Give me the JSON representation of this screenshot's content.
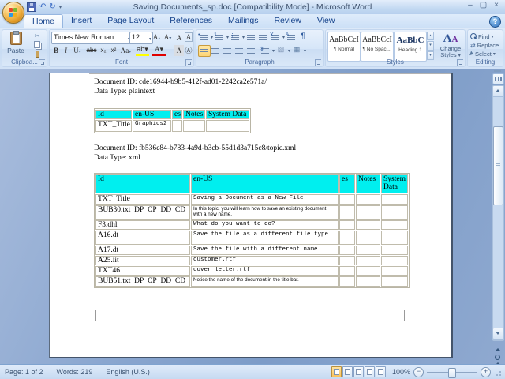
{
  "window": {
    "title": "Saving Documents_sp.doc [Compatibility Mode] - Microsoft Word",
    "minimize": "–",
    "maximize": "▢",
    "close": "×"
  },
  "icons": {
    "caret": "▾",
    "caret_up": "▴",
    "undo": "↶",
    "redo": "↻",
    "cut": "✂",
    "help": "?",
    "replace_arrows": "⇄",
    "line_spacing": "⇕",
    "shading": "▨",
    "borders": "▦",
    "multilevel": "⋮",
    "bullet": "•",
    "number": "1",
    "sort": "A↓",
    "asian": "X",
    "enclose": "Ⓐ"
  },
  "tabs": [
    {
      "label": "Home"
    },
    {
      "label": "Insert"
    },
    {
      "label": "Page Layout"
    },
    {
      "label": "References"
    },
    {
      "label": "Mailings"
    },
    {
      "label": "Review"
    },
    {
      "label": "View"
    }
  ],
  "ribbon": {
    "clipboard": {
      "group_label": "Clipboa...",
      "paste": "Paste"
    },
    "font": {
      "group_label": "Font",
      "name": "Times New Roman",
      "size": "12",
      "bold": "B",
      "italic": "I",
      "underline": "U",
      "strike": "abc",
      "subscript": "x₂",
      "superscript": "x²",
      "case": "Aa",
      "grow": "A",
      "shrink": "A",
      "highlight": "ab",
      "color": "A",
      "phonetic": "A",
      "char_border": "A",
      "char_shading": "A"
    },
    "paragraph": {
      "group_label": "Paragraph",
      "pilcrow": "¶"
    },
    "styles": {
      "group_label": "Styles",
      "cards": [
        {
          "sample": "AaBbCcI",
          "label": "¶ Normal"
        },
        {
          "sample": "AaBbCcI",
          "label": "¶ No Spaci..."
        },
        {
          "sample": "AaBbC",
          "label": "Heading 1"
        }
      ],
      "change1": "Change",
      "change2": "Styles"
    },
    "editing": {
      "group_label": "Editing",
      "find": "Find",
      "replace": "Replace",
      "select": "Select"
    }
  },
  "document": {
    "block1": {
      "line1": "Document ID: cde16944-b9b5-412f-ad01-2242ca2e571a/",
      "line2": "Data Type: plaintext"
    },
    "table1": {
      "headers": [
        "Id",
        "en-US",
        "es",
        "Notes",
        "System Data"
      ],
      "rows": [
        {
          "id": "TXT_Title",
          "en_us": "Graphics2"
        }
      ]
    },
    "block2": {
      "line1": "Document ID: fb536c84-b783-4a9d-b3cb-55d1d3a715c8/topic.xml",
      "line2": "Data Type: xml"
    },
    "table2": {
      "headers": [
        "Id",
        "en-US",
        "es",
        "Notes",
        "System Data"
      ],
      "rows": [
        {
          "id": "TXT_Title",
          "en_us": "Saving a Document as a New File"
        },
        {
          "id": "BUB30.txt_DP_CP_DD_CD",
          "en_us": "In this topic, you will learn how to save an existing document with a new name."
        },
        {
          "id": "F3.dhl",
          "en_us": "What do you want to do?"
        },
        {
          "id": "A16.dt",
          "en_us": "Save the file as a different file type"
        },
        {
          "id": "A17.dt",
          "en_us": "Save the file with a different name"
        },
        {
          "id": "A25.iit",
          "en_us": "customer.rtf"
        },
        {
          "id": "TXT46",
          "en_us": "cover letter.rtf"
        },
        {
          "id": "BUB51.txt_DP_CP_DD_CD",
          "en_us": "Notice the name of the document in the title bar."
        }
      ]
    }
  },
  "status": {
    "page": "Page: 1 of 2",
    "words": "Words: 219",
    "language": "English (U.S.)",
    "zoom": "100%"
  }
}
